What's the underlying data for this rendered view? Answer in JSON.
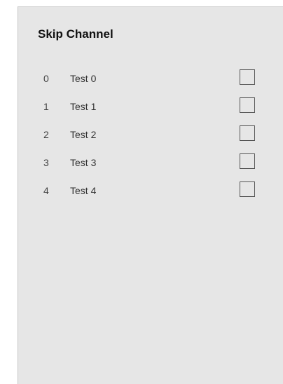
{
  "dialog": {
    "title": "Skip Channel"
  },
  "channels": [
    {
      "number": "0",
      "name": "Test 0",
      "skipped": false
    },
    {
      "number": "1",
      "name": "Test 1",
      "skipped": false
    },
    {
      "number": "2",
      "name": "Test 2",
      "skipped": false
    },
    {
      "number": "3",
      "name": "Test 3",
      "skipped": false
    },
    {
      "number": "4",
      "name": "Test 4",
      "skipped": false
    }
  ]
}
